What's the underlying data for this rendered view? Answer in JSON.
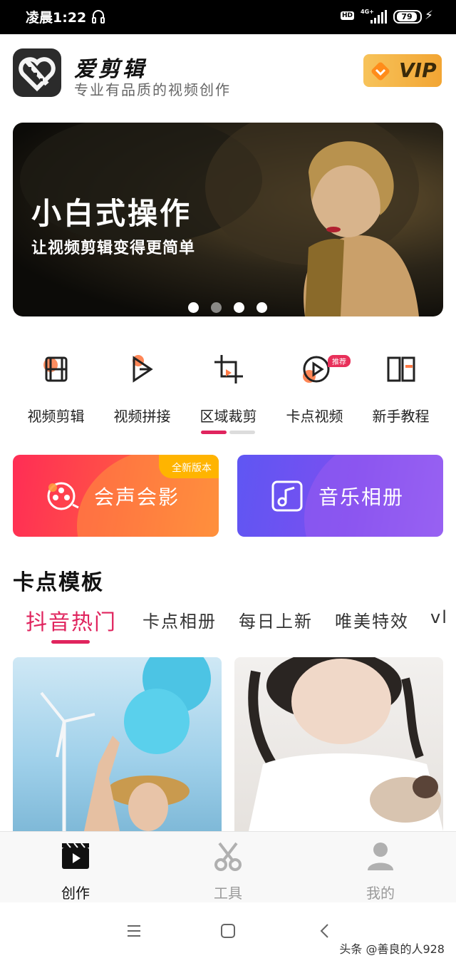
{
  "status_bar": {
    "time": "凌晨1:22",
    "hd": "HD",
    "network": "4G+",
    "battery": "79"
  },
  "header": {
    "app_name": "爱剪辑",
    "slogan": "专业有品质的视频创作",
    "vip_label": "VIP"
  },
  "banner": {
    "title": "小白式操作",
    "subtitle": "让视频剪辑变得更简单",
    "slide_count": 4,
    "active_index": 1
  },
  "tools": [
    {
      "label": "视频剪辑",
      "icon": "film-icon"
    },
    {
      "label": "视频拼接",
      "icon": "splice-icon"
    },
    {
      "label": "区域裁剪",
      "icon": "crop-icon"
    },
    {
      "label": "卡点视频",
      "icon": "beat-icon"
    },
    {
      "label": "新手教程",
      "icon": "book-icon"
    }
  ],
  "tools_badge": "推荐",
  "cards": {
    "left": {
      "label": "会声会影",
      "tag": "全新版本",
      "icon": "reel-icon"
    },
    "right": {
      "label": "音乐相册",
      "icon": "music-icon"
    }
  },
  "section_title": "卡点模板",
  "tabs": [
    "抖音热门",
    "卡点相册",
    "每日上新",
    "唯美特效",
    "vl"
  ],
  "active_tab": 0,
  "bottom_nav": [
    {
      "label": "创作",
      "icon": "clapper-icon",
      "active": true
    },
    {
      "label": "工具",
      "icon": "scissors-icon",
      "active": false
    },
    {
      "label": "我的",
      "icon": "user-icon",
      "active": false
    }
  ],
  "watermark": "头条 @善良的人928",
  "colors": {
    "accent": "#e0245e",
    "vip_gold": "#f2a533",
    "card_left": "#ff4e48",
    "card_right": "#6a52f2",
    "icon_orange": "#ff7a45"
  }
}
